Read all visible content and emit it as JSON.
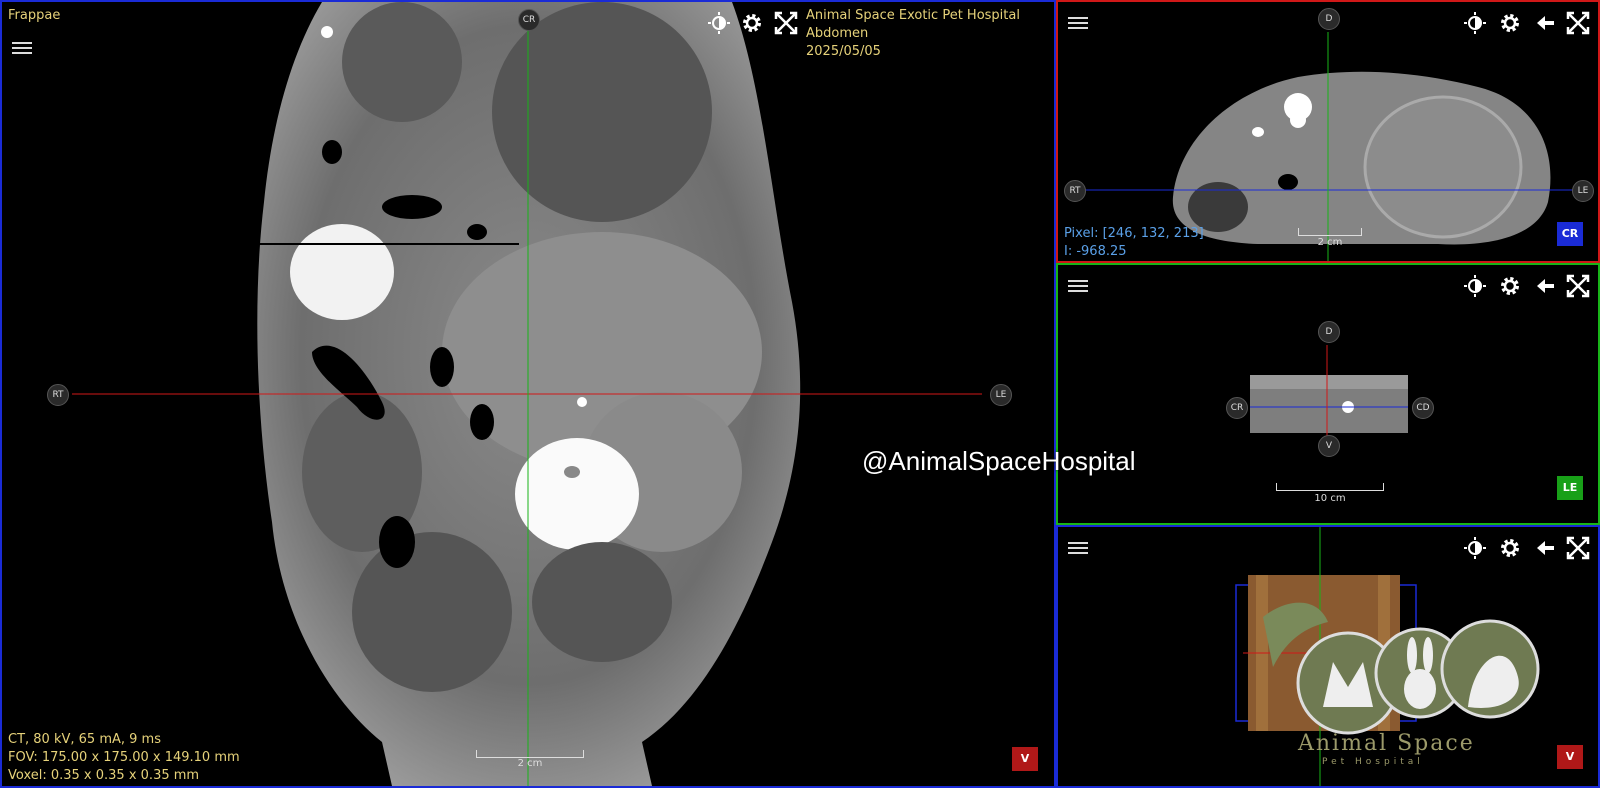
{
  "main": {
    "patient_name": "Frappae",
    "hospital_name": "Animal Space Exotic Pet Hospital",
    "study": "Abdomen",
    "date": "2025/05/05",
    "scan_params": "CT, 80 kV, 65 mA, 9 ms",
    "fov": "FOV: 175.00 x 175.00 x 149.10 mm",
    "voxel": "Voxel: 0.35 x 0.35 x 0.35 mm",
    "orient_top": "CR",
    "orient_left": "RT",
    "orient_right": "LE",
    "scale_label": "2 cm",
    "view_badge": "V"
  },
  "axial": {
    "orient_top": "D",
    "orient_left": "RT",
    "orient_right": "LE",
    "pixel_readout": "Pixel: [246, 132, 213]",
    "intensity_readout": "I: -968.25",
    "scale_label": "2 cm",
    "view_badge": "CR"
  },
  "sagittal": {
    "orient_top": "D",
    "orient_bottom": "V",
    "orient_left": "CR",
    "orient_right": "CD",
    "scale_label": "10 cm",
    "view_badge": "LE"
  },
  "volume3d": {
    "view_badge": "V",
    "logo_text": "Animal Space",
    "logo_subtext": "Pet Hospital"
  },
  "watermark": "@AnimalSpaceHospital",
  "colors": {
    "axial_border": "#d01818",
    "sagittal_border": "#18b418",
    "main_border": "#1a2bd6",
    "overlay_text": "#e6d27a",
    "readout_text": "#5aa0e8"
  },
  "icons": [
    "menu-icon",
    "brightness-icon",
    "gear-icon",
    "fullscreen-icon",
    "arrow-left-icon"
  ]
}
